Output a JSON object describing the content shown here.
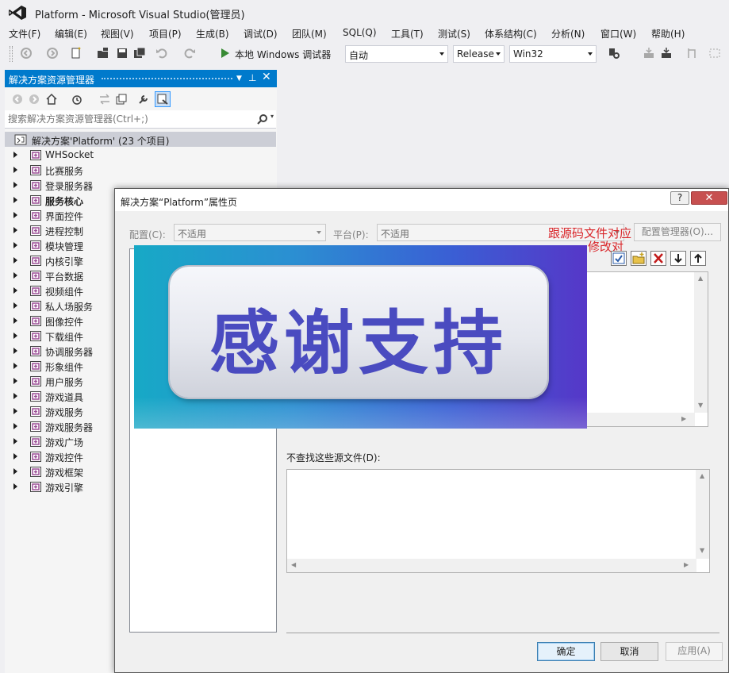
{
  "window": {
    "title": "Platform - Microsoft Visual Studio(管理员)"
  },
  "menu": [
    "文件(F)",
    "编辑(E)",
    "视图(V)",
    "项目(P)",
    "生成(B)",
    "调试(D)",
    "团队(M)",
    "SQL(Q)",
    "工具(T)",
    "测试(S)",
    "体系结构(C)",
    "分析(N)",
    "窗口(W)",
    "帮助(H)"
  ],
  "toolbar": {
    "debugger_label": "本地 Windows 调试器",
    "combo_auto": "自动",
    "combo_config": "Release",
    "combo_platform": "Win32"
  },
  "solution_explorer": {
    "title": "解决方案资源管理器",
    "search_placeholder": "搜索解决方案资源管理器(Ctrl+;)",
    "solution_label": "解决方案'Platform' (23 个项目)",
    "projects": [
      "WHSocket",
      "比赛服务",
      "登录服务器",
      "服务核心",
      "界面控件",
      "进程控制",
      "模块管理",
      "内核引擎",
      "平台数据",
      "视频组件",
      "私人场服务",
      "图像控件",
      "下载组件",
      "协调服务器",
      "形象组件",
      "用户服务",
      "游戏道具",
      "游戏服务",
      "游戏服务器",
      "游戏广场",
      "游戏控件",
      "游戏框架",
      "游戏引擎"
    ],
    "bold_project": "服务核心"
  },
  "dialog": {
    "title": "解决方案“Platform”属性页",
    "help_label": "?",
    "close_label": "✕",
    "config_label": "配置(C):",
    "config_value": "不适用",
    "platform_label": "平台(P):",
    "platform_value": "不适用",
    "config_manager_label": "配置管理器(O)...",
    "annotation_line1": "跟源码文件对应",
    "annotation_line2": "修改对",
    "exclude_label": "不查找这些源文件(D):",
    "ok_label": "确定",
    "cancel_label": "取消",
    "apply_label": "应用(A)"
  },
  "overlay": {
    "text": "感谢支持"
  },
  "colors": {
    "accent": "#007acc",
    "annotation": "#d9262a",
    "overlay_text": "#4a4bc0"
  }
}
